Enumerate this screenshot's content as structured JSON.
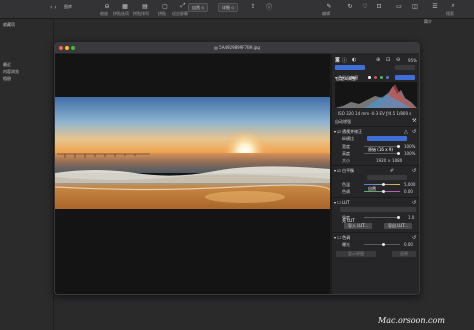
{
  "app": {
    "title": "图库",
    "toolbar_labels": [
      "缩放",
      "拼贴选项",
      "拼贴排列",
      "拼贴",
      "适应屏幕",
      "编辑",
      "",
      "搜索"
    ],
    "pill_1": "自然 ◇",
    "pill_2": "详细 ◇"
  },
  "sidebar": {
    "title": "收藏项",
    "items": [
      "最近",
      "内容浏览",
      "相册"
    ]
  },
  "host_right": {
    "title": "简介"
  },
  "window": {
    "filename": "5A4929899F7B9.jpg",
    "zoom": "95%"
  },
  "inspector": {
    "preset_select": "自定义调整",
    "histogram_label": "色彩分布图",
    "exif": "ISO 320  14 mm  -0.3 EV  ƒ/4.5  1/800 s",
    "auto_enhance": "自动增强",
    "lens": {
      "title": "透视并修正",
      "rows": [
        {
          "label": "纵横比",
          "value": "原始 (16 x 9)"
        },
        {
          "label": "宽度",
          "value": "100%"
        },
        {
          "label": "高度",
          "value": "100%"
        },
        {
          "label": "大小",
          "value": "1920 × 1080"
        }
      ]
    },
    "white_balance": {
      "title": "白平衡",
      "mode": "自然",
      "rows": [
        {
          "label": "色温",
          "value": "5,000"
        },
        {
          "label": "色调",
          "value": "0.00"
        }
      ]
    },
    "lut": {
      "title": "LUT",
      "select": "无 LUT",
      "intensity_label": "强度",
      "intensity_value": "1.0",
      "import_button": "导入 LUT...",
      "export_button": "导出 LUT..."
    },
    "color": {
      "title": "色调",
      "row_label": "曝光",
      "row_value": "0.00"
    },
    "bottom_buttons": [
      "显示原图",
      "还原"
    ]
  },
  "watermark": "Mac.orsoon.com",
  "colors": {
    "accent": "#3d6fd6",
    "close": "#fe5f57",
    "minimize": "#febc2e",
    "zoom": "#28c840"
  }
}
